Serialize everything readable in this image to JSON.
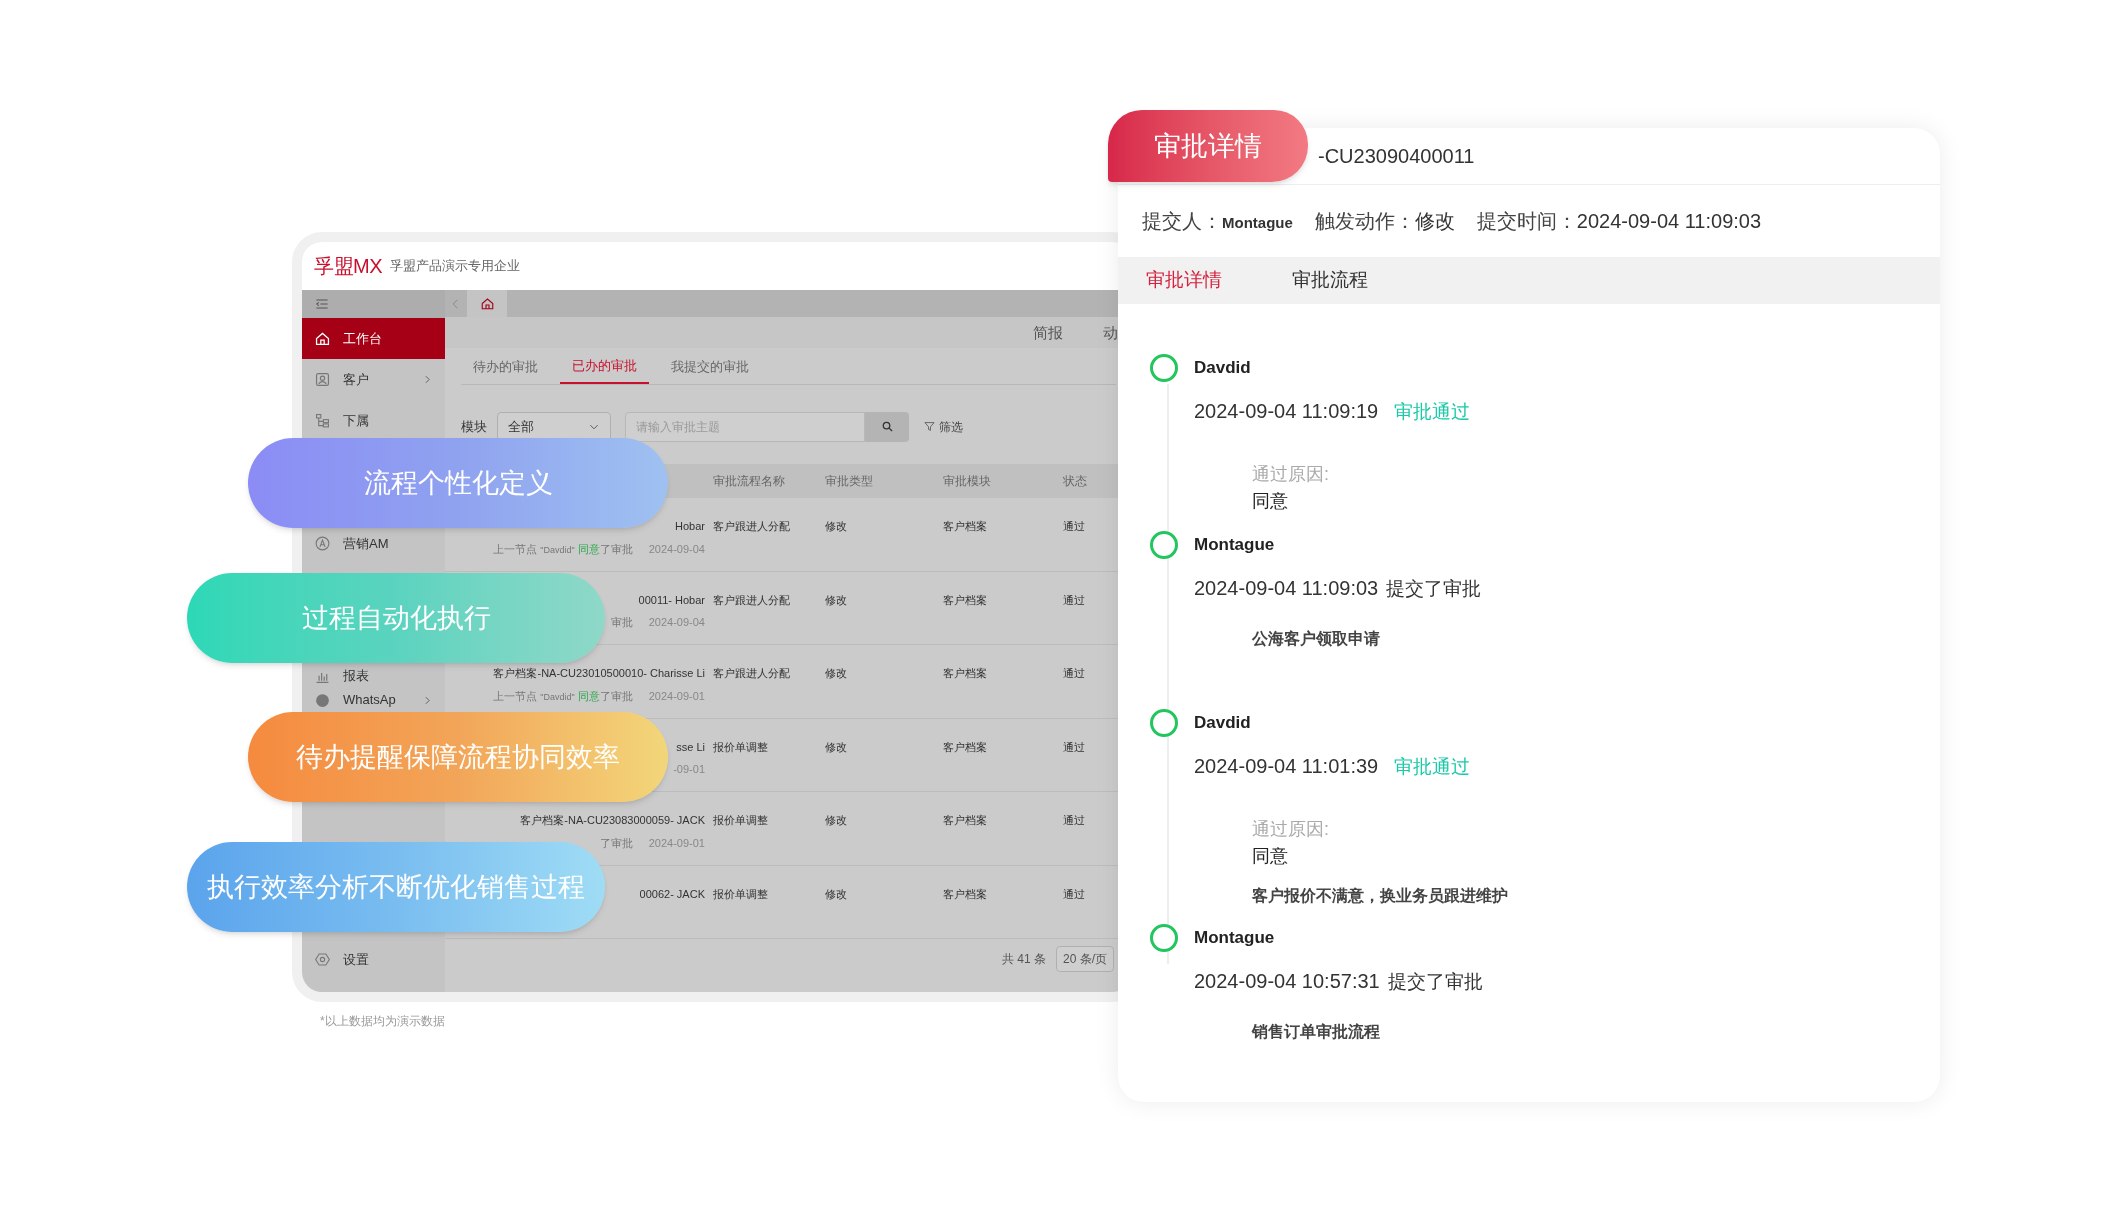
{
  "app": {
    "brand": "孚盟MX",
    "company": "孚盟产品演示专用企业",
    "sidebar": [
      {
        "label": "工作台",
        "selected": true,
        "chevron": false
      },
      {
        "label": "客户",
        "selected": false,
        "chevron": true
      },
      {
        "label": "下属",
        "selected": false,
        "chevron": false
      },
      {
        "label": "营销AM",
        "selected": false,
        "chevron": false
      },
      {
        "label": "报表",
        "selected": false,
        "chevron": false
      },
      {
        "label": "WhatsAp",
        "selected": false,
        "chevron": true
      }
    ],
    "settings": "设置",
    "top_links": [
      "简报",
      "动"
    ],
    "tabs": [
      {
        "label": "待办的审批",
        "selected": false
      },
      {
        "label": "已办的审批",
        "selected": true
      },
      {
        "label": "我提交的审批",
        "selected": false
      }
    ],
    "filter": {
      "label": "模块",
      "value": "全部",
      "placeholder": "请输入审批主题",
      "filter_button": "筛选"
    },
    "columns": [
      "审批流程名称",
      "审批类型",
      "审批模块",
      "状态"
    ],
    "rows": [
      {
        "name": "Hobar",
        "flow": "客户跟进人分配",
        "type": "修改",
        "module": "客户档案",
        "status": "通过",
        "sub": [
          {
            "kind": "muted",
            "text": "上一节点"
          },
          {
            "kind": "node",
            "text": "\"Davdid\""
          },
          {
            "kind": "green",
            "text": "同意"
          },
          {
            "kind": "muted",
            "text": "了审批"
          },
          {
            "kind": "date",
            "text": "2024-09-04"
          }
        ]
      },
      {
        "name": "00011- Hobar",
        "flow": "客户跟进人分配",
        "type": "修改",
        "module": "客户档案",
        "status": "通过",
        "sub": [
          {
            "kind": "muted",
            "text": "审批"
          },
          {
            "kind": "date",
            "text": "2024-09-04"
          }
        ]
      },
      {
        "name": "客户档案-NA-CU23010500010- Charisse Li",
        "flow": "客户跟进人分配",
        "type": "修改",
        "module": "客户档案",
        "status": "通过",
        "sub": [
          {
            "kind": "muted",
            "text": "上一节点"
          },
          {
            "kind": "node",
            "text": "\"Davdid\""
          },
          {
            "kind": "green",
            "text": "同意"
          },
          {
            "kind": "muted",
            "text": "了审批"
          },
          {
            "kind": "date",
            "text": "2024-09-01"
          }
        ]
      },
      {
        "name": "sse Li",
        "flow": "报价单调整",
        "type": "修改",
        "module": "客户档案",
        "status": "通过",
        "sub": [
          {
            "kind": "date",
            "text": "-09-01"
          }
        ]
      },
      {
        "name": "客户档案-NA-CU23083000059- JACK",
        "flow": "报价单调整",
        "type": "修改",
        "module": "客户档案",
        "status": "通过",
        "sub": [
          {
            "kind": "muted",
            "text": "了审批"
          },
          {
            "kind": "date",
            "text": "2024-09-01"
          }
        ]
      },
      {
        "name": "00062- JACK",
        "flow": "报价单调整",
        "type": "修改",
        "module": "客户档案",
        "status": "通过",
        "sub": []
      }
    ],
    "total": "共 41 条",
    "page_size": "20 条/页"
  },
  "footnote": "*以上数据均为演示数据",
  "features": [
    {
      "text": "流程个性化定义",
      "kind": "purple"
    },
    {
      "text": "过程自动化执行",
      "kind": "teal"
    },
    {
      "text": "待办提醒保障流程协同效率",
      "kind": "orange"
    },
    {
      "text": "执行效率分析不断优化销售过程",
      "kind": "blue"
    }
  ],
  "detail": {
    "tag": "审批详情",
    "record": "-CU23090400011",
    "meta": [
      {
        "label": "提交人：",
        "value": "Montague"
      },
      {
        "label": "触发动作：",
        "value": "修改"
      },
      {
        "label": "提交时间：",
        "value": "2024-09-04 11:09:03"
      }
    ],
    "tabs": [
      {
        "label": "审批详情",
        "selected": true
      },
      {
        "label": "审批流程",
        "selected": false
      }
    ],
    "timeline": [
      {
        "name": "Davdid",
        "time": "2024-09-04 11:09:19",
        "action": "审批通过",
        "kind": "approve",
        "reason_label": "通过原因:",
        "reason": "同意"
      },
      {
        "name": "Montague",
        "time": "2024-09-04 11:09:03",
        "action": "提交了审批",
        "kind": "submit",
        "note": "公海客户领取申请"
      },
      {
        "name": "Davdid",
        "time": "2024-09-04 11:01:39",
        "action": "审批通过",
        "kind": "approve",
        "reason_label": "通过原因:",
        "reason": "同意",
        "note": "客户报价不满意，换业务员跟进维护"
      },
      {
        "name": "Montague",
        "time": "2024-09-04 10:57:31",
        "action": "提交了审批",
        "kind": "submit",
        "note": "销售订单审批流程"
      }
    ]
  }
}
